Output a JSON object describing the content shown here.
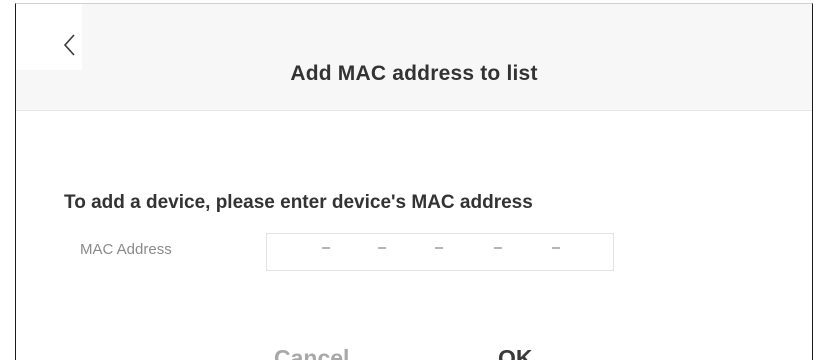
{
  "dialog": {
    "title": "Add MAC address to list",
    "back_icon": "chevron-left-icon",
    "instruction": "To add a device, please enter device's MAC address",
    "mac_field": {
      "label": "MAC Address",
      "value": "",
      "separator": "-",
      "segment_count": 6
    },
    "buttons": {
      "cancel_label": "Cancel",
      "ok_label": "OK"
    }
  },
  "colors": {
    "header_background": "#f7f7f7",
    "title_text": "#333333",
    "cancel_text": "#a8a8a8",
    "ok_text": "#3a3a3a",
    "ok_accent": "#f4c31a"
  }
}
